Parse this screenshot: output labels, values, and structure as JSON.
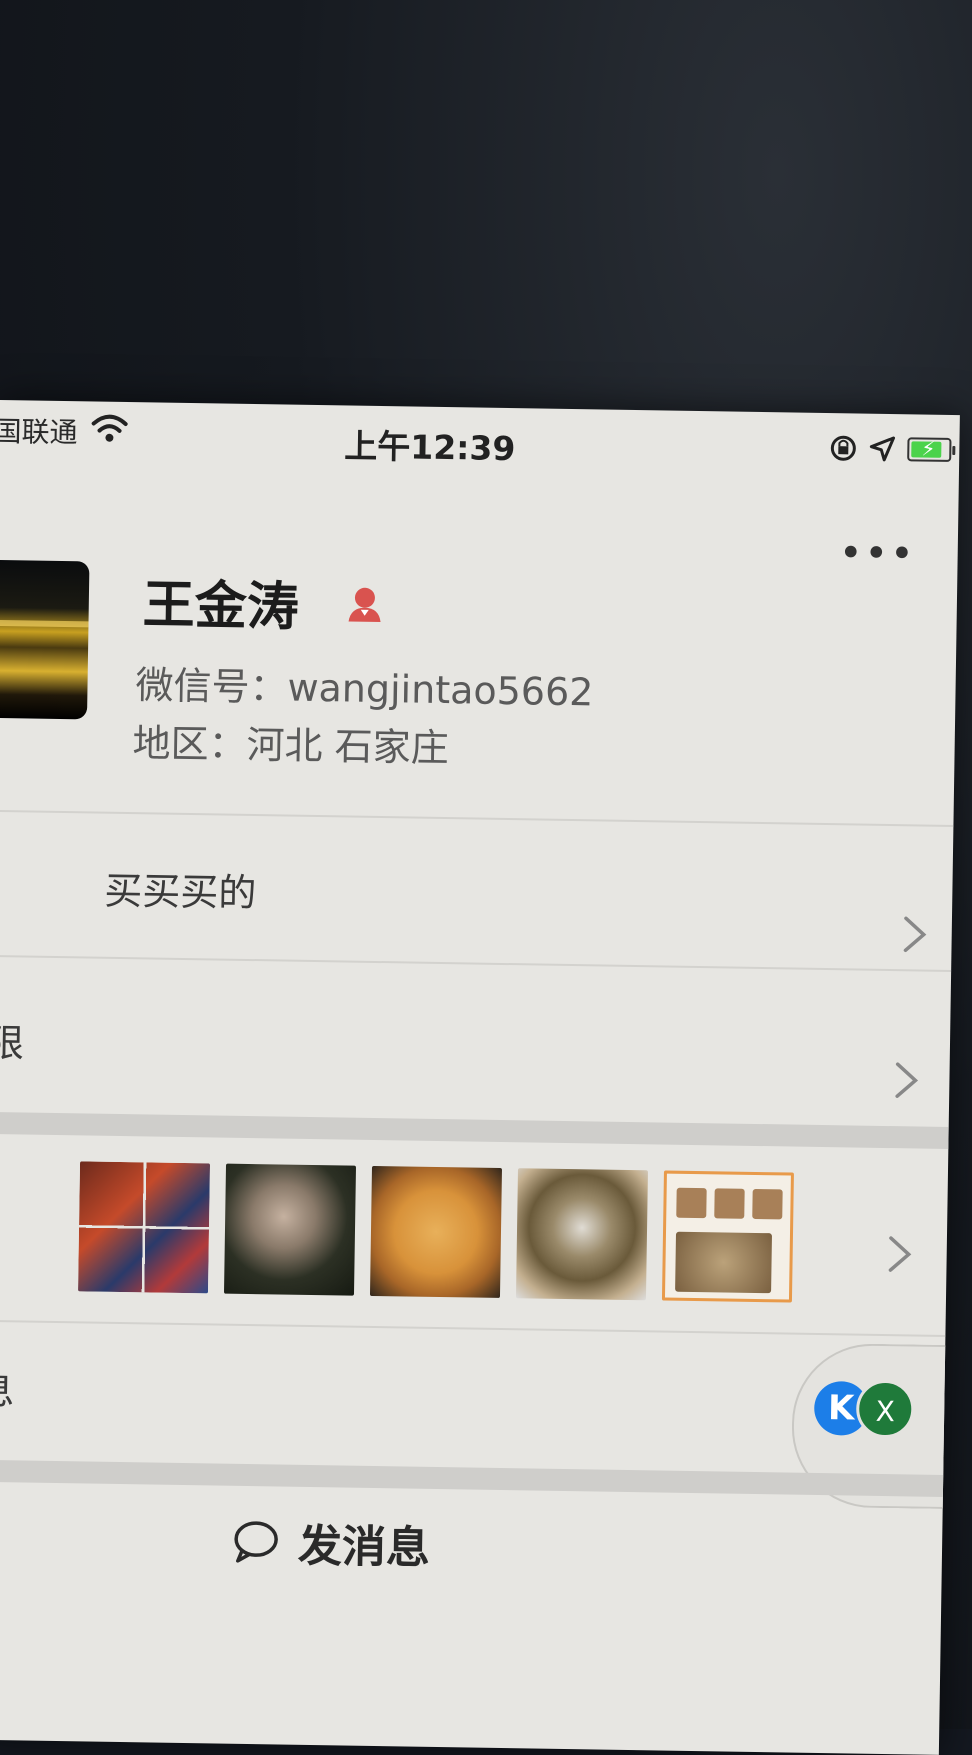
{
  "status_bar": {
    "carrier": "国联通",
    "time": "上午12:39"
  },
  "profile": {
    "name": "王金涛",
    "wechat_id": "微信号：wangjintao5662",
    "region": "地区：河北 石家庄"
  },
  "rows": {
    "remark": "买买买的",
    "permissions": "限",
    "info": "息"
  },
  "actions": {
    "send_message": "发消息",
    "float_close": "X",
    "float_logo": "K"
  },
  "colors": {
    "battery_green": "#4bd34b",
    "gender_icon": "#d9534f",
    "float_logo_blue": "#1c7ee8",
    "float_close_green": "#1f7a3a"
  }
}
